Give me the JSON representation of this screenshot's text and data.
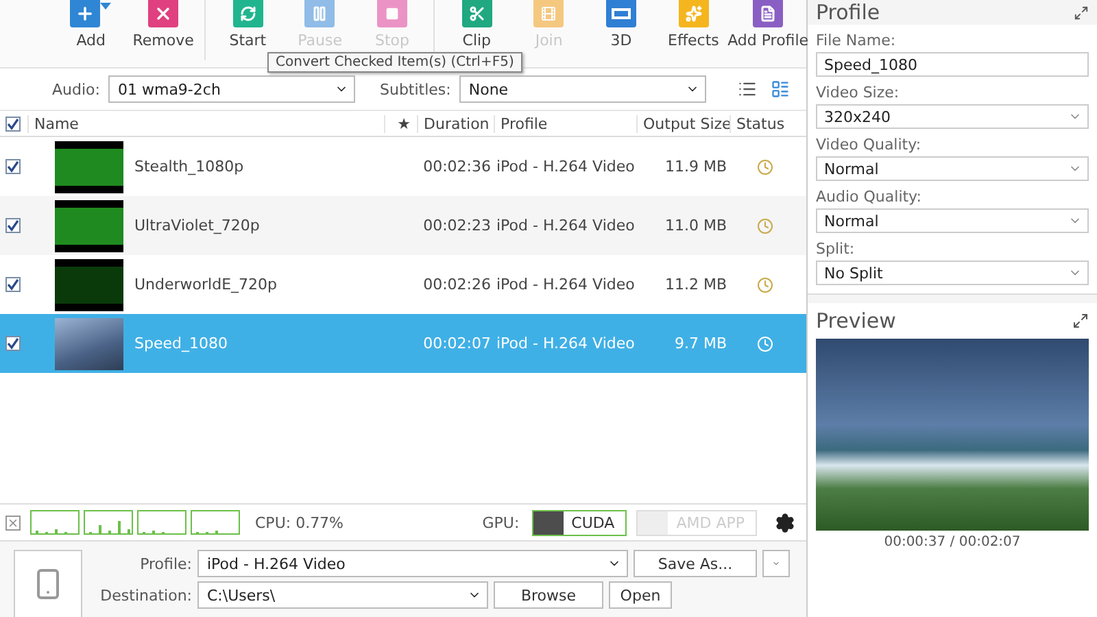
{
  "toolbar": {
    "buttons": [
      {
        "label": "Add",
        "disabled": false
      },
      {
        "label": "Remove",
        "disabled": false
      },
      {
        "label": "Start",
        "disabled": false
      },
      {
        "label": "Pause",
        "disabled": true
      },
      {
        "label": "Stop",
        "disabled": true
      },
      {
        "label": "Clip",
        "disabled": false
      },
      {
        "label": "Join",
        "disabled": true
      },
      {
        "label": "3D",
        "disabled": false
      },
      {
        "label": "Effects",
        "disabled": false
      },
      {
        "label": "Add Profile",
        "disabled": false
      }
    ],
    "tooltip": "Convert Checked Item(s) (Ctrl+F5)"
  },
  "filters": {
    "audio_label": "Audio:",
    "audio": "01 wma9-2ch",
    "subtitles_label": "Subtitles:",
    "subtitles": "None",
    "views": [
      {
        "kind": "list",
        "selected": false
      },
      {
        "kind": "detail",
        "selected": true
      }
    ]
  },
  "table": {
    "all_checked": true,
    "columns": [
      "Name",
      "★",
      "Duration",
      "Profile",
      "Output Size",
      "Status"
    ],
    "rows": [
      {
        "checked": true,
        "selected": false,
        "kind": "title-card",
        "name": "Stealth_1080p",
        "duration": "00:02:36",
        "profile": "iPod - H.264 Video",
        "size": "11.9 MB"
      },
      {
        "checked": true,
        "selected": false,
        "kind": "title-card",
        "name": "UltraViolet_720p",
        "duration": "00:02:23",
        "profile": "iPod - H.264 Video",
        "size": "11.0 MB"
      },
      {
        "checked": true,
        "selected": false,
        "kind": "dark-card",
        "name": "UnderworldE_720p",
        "duration": "00:02:26",
        "profile": "iPod - H.264 Video",
        "size": "11.2 MB"
      },
      {
        "checked": true,
        "selected": true,
        "kind": "landscape",
        "name": "Speed_1080",
        "duration": "00:02:07",
        "profile": "iPod - H.264 Video",
        "size": "9.7 MB"
      }
    ]
  },
  "status_bar": {
    "cpu": "CPU: 0.77%",
    "gpu_label": "GPU:",
    "gpu_options": [
      {
        "label": "CUDA",
        "on": true
      },
      {
        "label": "AMD APP",
        "on": false
      }
    ]
  },
  "output": {
    "profile_label": "Profile:",
    "profile": "iPod - H.264 Video",
    "save_as": "Save As...",
    "destination_label": "Destination:",
    "destination": "C:\\Users\\",
    "browse": "Browse",
    "open": "Open"
  },
  "profile_panel": {
    "title": "Profile",
    "fields": [
      {
        "label": "File Name:",
        "value": "Speed_1080",
        "kind": "text"
      },
      {
        "label": "Video Size:",
        "value": "320x240",
        "kind": "select"
      },
      {
        "label": "Video Quality:",
        "value": "Normal",
        "kind": "select"
      },
      {
        "label": "Audio Quality:",
        "value": "Normal",
        "kind": "select"
      },
      {
        "label": "Split:",
        "value": "No Split",
        "kind": "select"
      }
    ]
  },
  "preview": {
    "title": "Preview",
    "time": "00:00:37 / 00:02:07"
  }
}
